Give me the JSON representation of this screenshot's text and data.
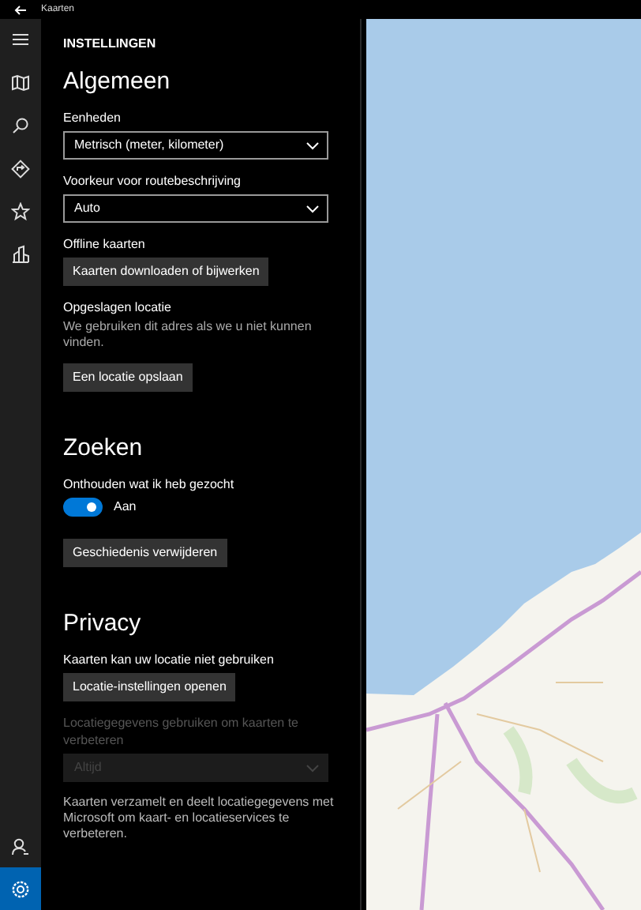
{
  "title_bar": {
    "title": "Kaarten"
  },
  "nav": {
    "top_items": [
      {
        "selected": false
      },
      {
        "selected": false
      },
      {
        "selected": false
      },
      {
        "selected": false
      },
      {
        "selected": false
      },
      {
        "selected": false
      }
    ],
    "bottom_items": [
      {
        "selected": false
      },
      {
        "selected": true
      }
    ]
  },
  "settings": {
    "heading": "INSTELLINGEN",
    "sections": [
      {
        "title": "Algemeen",
        "items": [
          {
            "kind": "dropdown",
            "label": "Eenheden",
            "value": "Metrisch (meter, kilometer)",
            "disabled": false
          },
          {
            "kind": "dropdown",
            "label": "Voorkeur voor routebeschrijving",
            "value": "Auto",
            "disabled": false
          },
          {
            "kind": "button",
            "label": "Offline kaarten",
            "button": "Kaarten downloaden of bijwerken"
          },
          {
            "kind": "button",
            "label": "Opgeslagen locatie",
            "description": "We gebruiken dit adres als we u niet kunnen vinden.",
            "button": "Een locatie opslaan"
          }
        ]
      },
      {
        "title": "Zoeken",
        "items": [
          {
            "kind": "toggle",
            "label": "Onthouden wat ik heb gezocht",
            "on": true,
            "state_text": "Aan"
          },
          {
            "kind": "button",
            "button": "Geschiedenis verwijderen"
          }
        ]
      },
      {
        "title": "Privacy",
        "items": [
          {
            "kind": "button",
            "label": "Kaarten kan uw locatie niet gebruiken",
            "button": "Locatie-instellingen openen"
          },
          {
            "kind": "dropdown",
            "label": "Locatiegegevens gebruiken om kaarten te verbeteren",
            "value": "Altijd",
            "disabled": true
          },
          {
            "kind": "text",
            "text": "Kaarten verzamelt en deelt locatiegegevens met Microsoft om kaart- en locatieservices te verbeteren."
          }
        ]
      }
    ]
  }
}
